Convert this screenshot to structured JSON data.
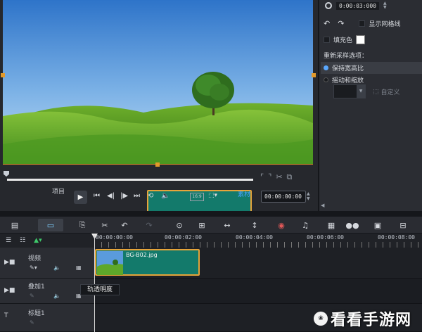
{
  "options_panel": {
    "timecode": "0:00:03:000",
    "show_grid_label": "显示网格线",
    "fill_color_label": "填充色",
    "fill_color": "#ffffff",
    "resample_title": "重新采样选项：",
    "keep_aspect_label": "保持宽高比",
    "crop_scale_label": "摇动和缩放",
    "custom_label": "自定义"
  },
  "preview": {
    "mode_project": "项目",
    "mode_clip": "素材",
    "ratio_label": "16:9",
    "timecode": "00:00:00:00"
  },
  "ruler": {
    "labels": [
      "00:00:00:00",
      "00:00:02:00",
      "00:00:04:00",
      "00:00:06:00",
      "00:00:08:00"
    ]
  },
  "tracks": {
    "video_label": "视频",
    "overlay_label": "叠加1",
    "title_label": "标题1",
    "clip_name": "BG-B02.jpg",
    "tooltip": "轨透明度"
  },
  "watermark": {
    "text": "看看手游网",
    "logo_text": "❀"
  },
  "colors": {
    "accent_orange": "#e6a43a",
    "clip_teal": "#137a6b",
    "selection_blue": "#5aa8ff"
  }
}
